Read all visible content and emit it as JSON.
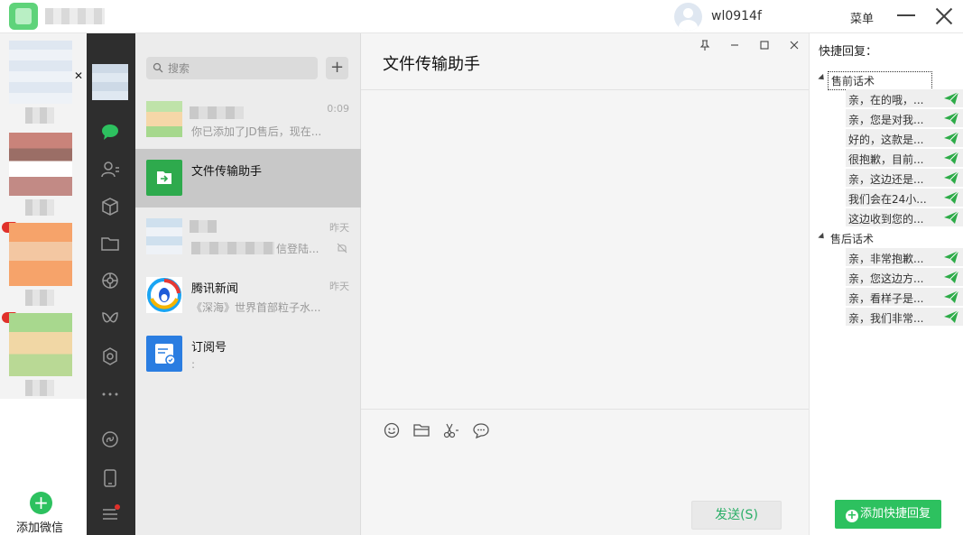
{
  "topbar": {
    "username": "wl0914f",
    "menu_label": "菜单"
  },
  "accounts": {
    "add_label": "添加微信"
  },
  "search": {
    "placeholder": "搜索"
  },
  "chats": [
    {
      "name": "",
      "preview": "你已添加了JD售后，现在...",
      "time": "0:09"
    },
    {
      "name": "文件传输助手",
      "preview": "",
      "time": ""
    },
    {
      "name": "",
      "preview": "信登陆...",
      "time": "昨天"
    },
    {
      "name": "腾讯新闻",
      "preview": "《深海》世界首部粒子水...",
      "time": "昨天"
    },
    {
      "name": "订阅号",
      "preview": ":",
      "time": ""
    }
  ],
  "chat_window": {
    "title": "文件传输助手",
    "send_label": "发送(S)"
  },
  "quick_reply": {
    "title": "快捷回复：",
    "groups": [
      {
        "label": "售前话术",
        "items": [
          "亲，在的哦，...",
          "亲，您是对我...",
          "好的，这款是...",
          "很抱歉，目前...",
          "亲，这边还是...",
          "我们会在24小...",
          "这边收到您的..."
        ]
      },
      {
        "label": "售后话术",
        "items": [
          "亲，非常抱歉...",
          "亲，您这边方...",
          "亲，看样子是...",
          "亲，我们非常..."
        ]
      }
    ],
    "add_label": "添加快捷回复"
  },
  "colors": {
    "brand_green": "#2dc15f",
    "sidebar_dark": "#2e2e2e",
    "chat_list_bg": "#ececec",
    "selected_chat": "#c8c8c8",
    "send_text": "#2aae67"
  }
}
